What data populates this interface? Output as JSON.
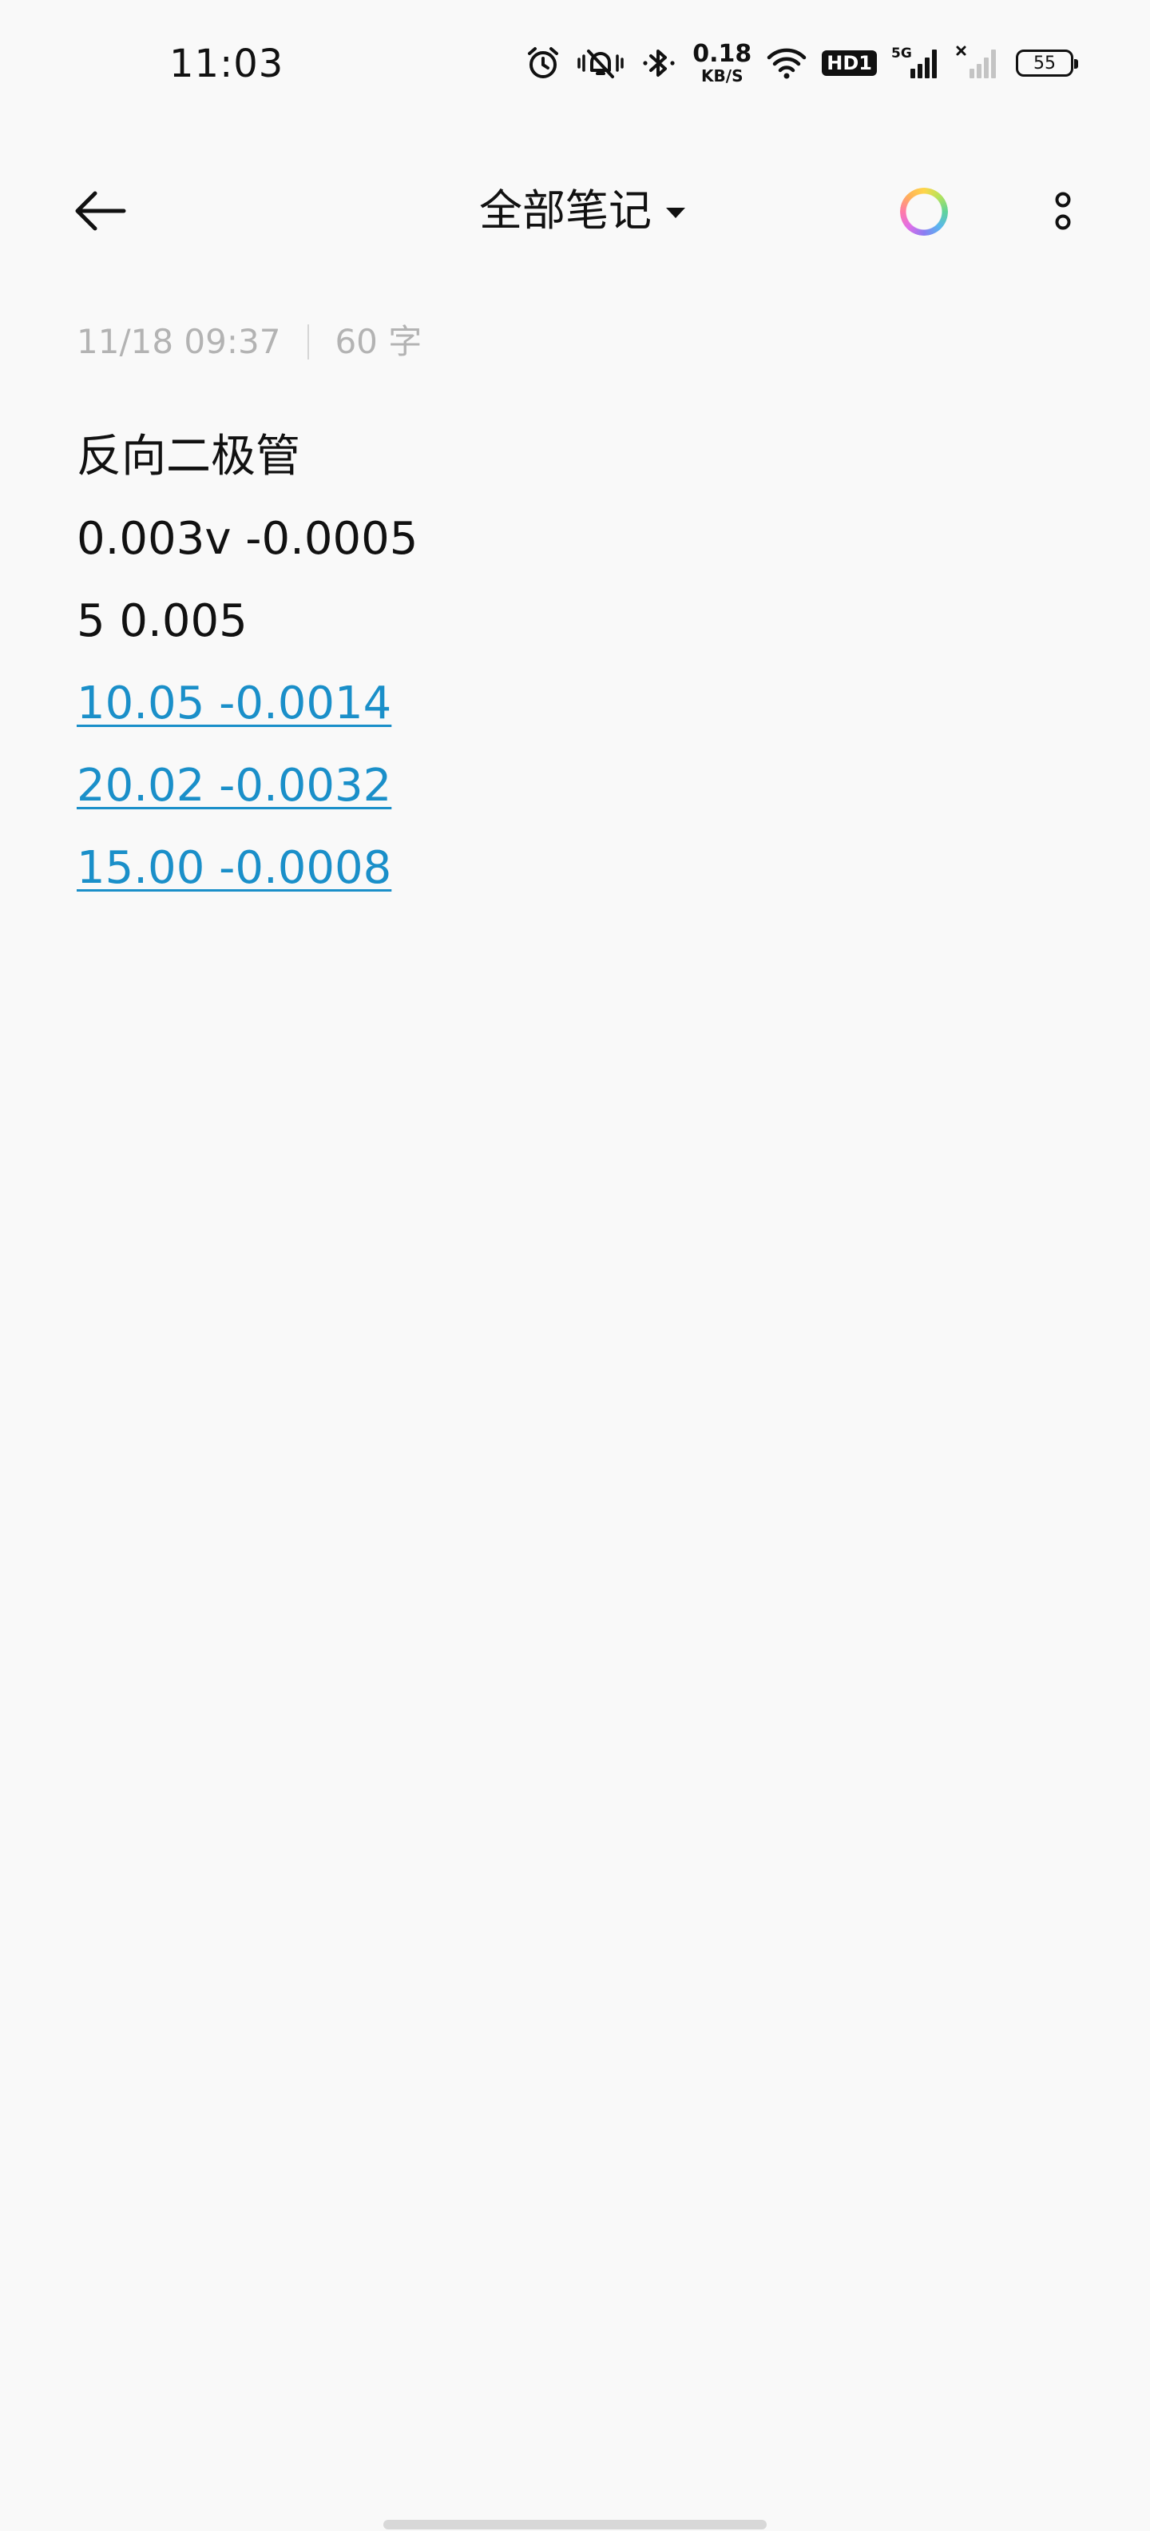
{
  "status_bar": {
    "time": "11:03",
    "net_speed_value": "0.18",
    "net_speed_unit": "KB/S",
    "hd_label": "HD1",
    "network_type": "5G",
    "battery_level": "55",
    "icons": [
      "alarm-icon",
      "mute-vibrate-icon",
      "bluetooth-icon",
      "wifi-icon",
      "hd-icon",
      "signal-5g-icon",
      "signal-no-service-icon",
      "battery-icon"
    ]
  },
  "header": {
    "title": "全部笔记",
    "back_icon": "arrow-left-icon",
    "dropdown_icon": "caret-down-icon",
    "color_icon": "color-ring-icon",
    "more_icon": "more-vertical-icon"
  },
  "note": {
    "datetime": "11/18 09:37",
    "word_count": "60 字",
    "lines": [
      {
        "text": "反向二极管",
        "link": false
      },
      {
        "text": "0.003v -0.0005",
        "link": false
      },
      {
        "text": "5 0.005",
        "link": false
      },
      {
        "text": "10.05 -0.0014",
        "link": true
      },
      {
        "text": "20.02 -0.0032",
        "link": true
      },
      {
        "text": "15.00 -0.0008",
        "link": true
      }
    ]
  },
  "colors": {
    "background": "#f9f9f9",
    "text": "#111111",
    "meta_text": "#b3b3b3",
    "link": "#1a8fc9"
  }
}
